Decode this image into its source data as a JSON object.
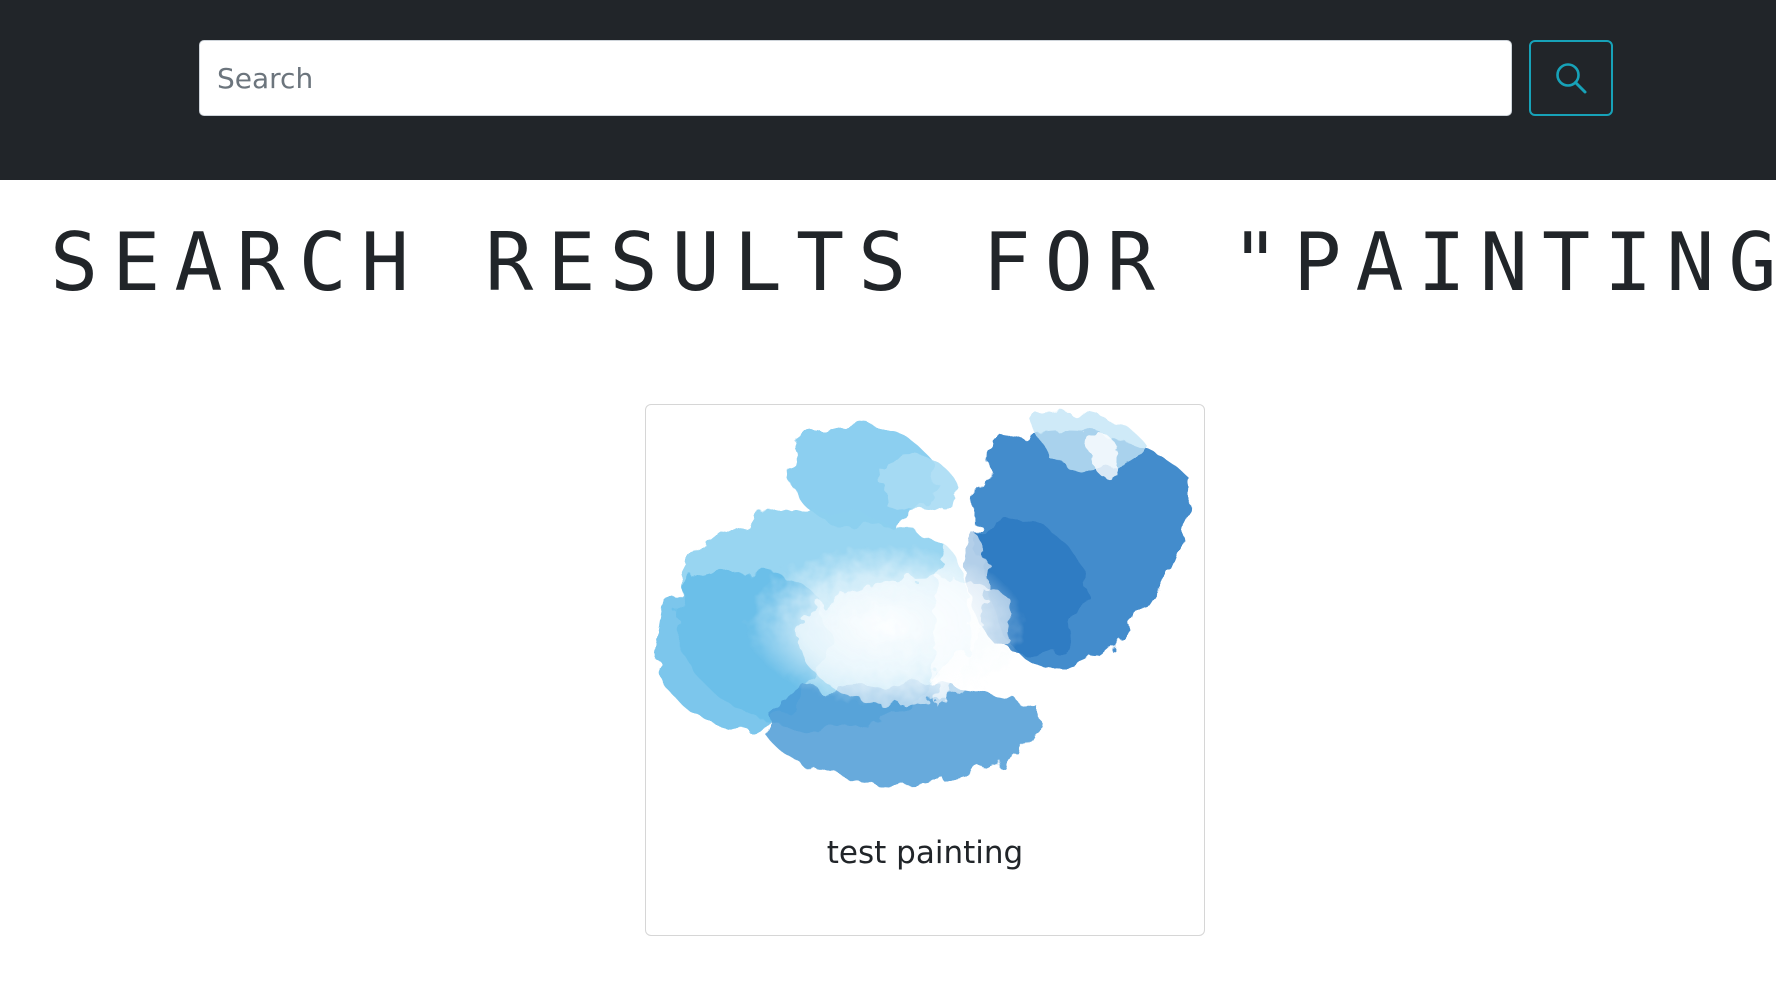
{
  "navbar": {
    "background": "#212529",
    "search": {
      "placeholder": "Search",
      "value": "",
      "button_icon": "search-icon",
      "button_color": "#17a2b8"
    }
  },
  "main": {
    "heading": "SEARCH RESULTS FOR \"PAINTING\"",
    "results": [
      {
        "title": "test painting",
        "image": "blue-watercolor-painting"
      }
    ]
  }
}
